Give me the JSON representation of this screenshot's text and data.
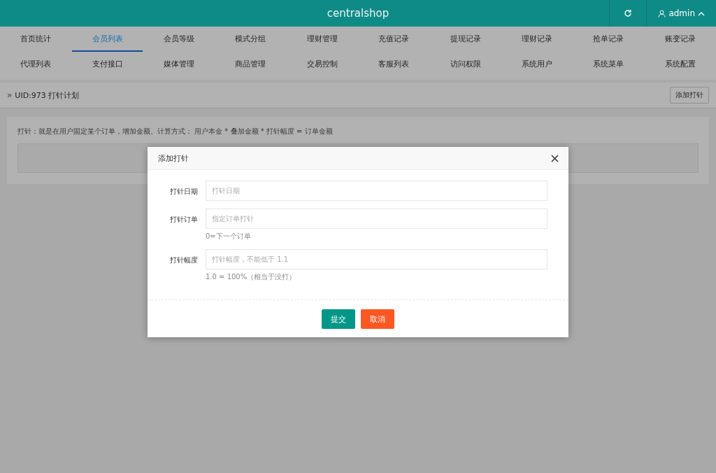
{
  "header": {
    "title": "centralshop",
    "user": "admin"
  },
  "nav": [
    {
      "label": "首页统计",
      "selected": false
    },
    {
      "label": "会员列表",
      "selected": true
    },
    {
      "label": "会员等级",
      "selected": false
    },
    {
      "label": "模式分组",
      "selected": false
    },
    {
      "label": "理财管理",
      "selected": false
    },
    {
      "label": "充值记录",
      "selected": false
    },
    {
      "label": "提现记录",
      "selected": false
    },
    {
      "label": "理财记录",
      "selected": false
    },
    {
      "label": "抢单记录",
      "selected": false
    },
    {
      "label": "账变记录",
      "selected": false
    },
    {
      "label": "代理列表",
      "selected": false
    },
    {
      "label": "支付接口",
      "selected": false
    },
    {
      "label": "媒体管理",
      "selected": false
    },
    {
      "label": "商品管理",
      "selected": false
    },
    {
      "label": "交易控制",
      "selected": false
    },
    {
      "label": "客服列表",
      "selected": false
    },
    {
      "label": "访问权限",
      "selected": false
    },
    {
      "label": "系统用户",
      "selected": false
    },
    {
      "label": "系统菜单",
      "selected": false
    },
    {
      "label": "系统配置",
      "selected": false
    }
  ],
  "breadcrumb": {
    "marker": "»",
    "title": "UID:973 打针计划",
    "button": "添加打针"
  },
  "info": "打针：就是在用户固定某个订单，增加金额。计算方式： 用户本金 * 叠加金额 * 打针幅度 = 订单金额",
  "dialog": {
    "title": "添加打针",
    "fields": [
      {
        "label": "打针日期",
        "placeholder": "打针日期"
      },
      {
        "label": "打针订单",
        "placeholder": "指定订单打针",
        "hint": "0=下一个订单"
      },
      {
        "label": "打针幅度",
        "placeholder": "打针幅度，不能低于 1.1",
        "hint": "1.0 = 100%（相当于没打）"
      }
    ],
    "submit": "提交",
    "cancel": "取消"
  }
}
